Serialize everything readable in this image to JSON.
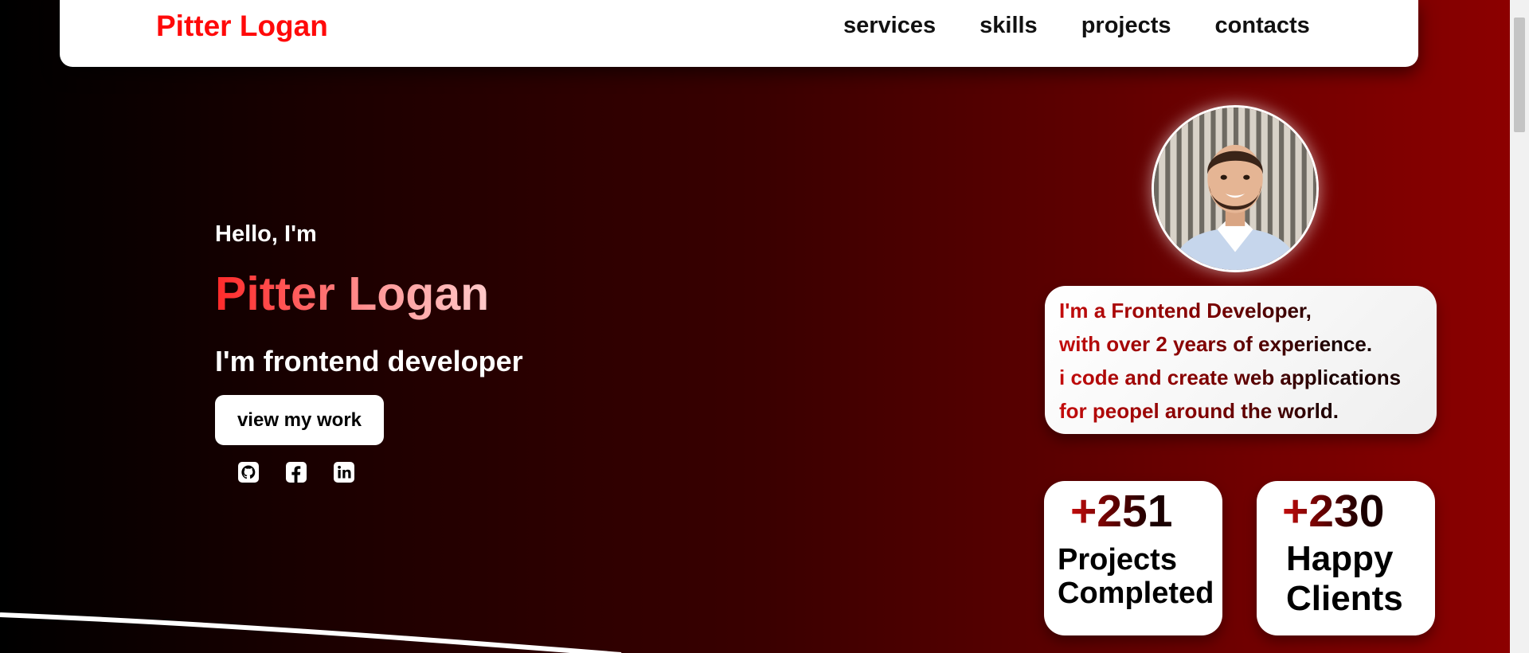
{
  "header": {
    "brand": "Pitter Logan",
    "nav": [
      {
        "label": "services"
      },
      {
        "label": "skills"
      },
      {
        "label": "projects"
      },
      {
        "label": "contacts"
      }
    ]
  },
  "hero": {
    "greeting": "Hello, I'm",
    "name": "Pitter Logan",
    "role": "I'm frontend developer",
    "cta_label": "view my work",
    "socials": [
      {
        "icon": "github-icon"
      },
      {
        "icon": "facebook-icon"
      },
      {
        "icon": "linkedin-icon"
      }
    ]
  },
  "intro": {
    "lines": [
      "I'm a Frontend Developer,",
      "with over 2 years of experience.",
      "i code and create web applications",
      "for peopel around the world."
    ]
  },
  "stats": [
    {
      "number": "+251",
      "label": "Projects\nCompleted"
    },
    {
      "number": "+230",
      "label": "Happy\nClients"
    }
  ],
  "colors": {
    "brand": "#ff0a0a",
    "accent_red": "#c40c0c",
    "background_dark": "#000000",
    "background_red": "#8e0000"
  }
}
